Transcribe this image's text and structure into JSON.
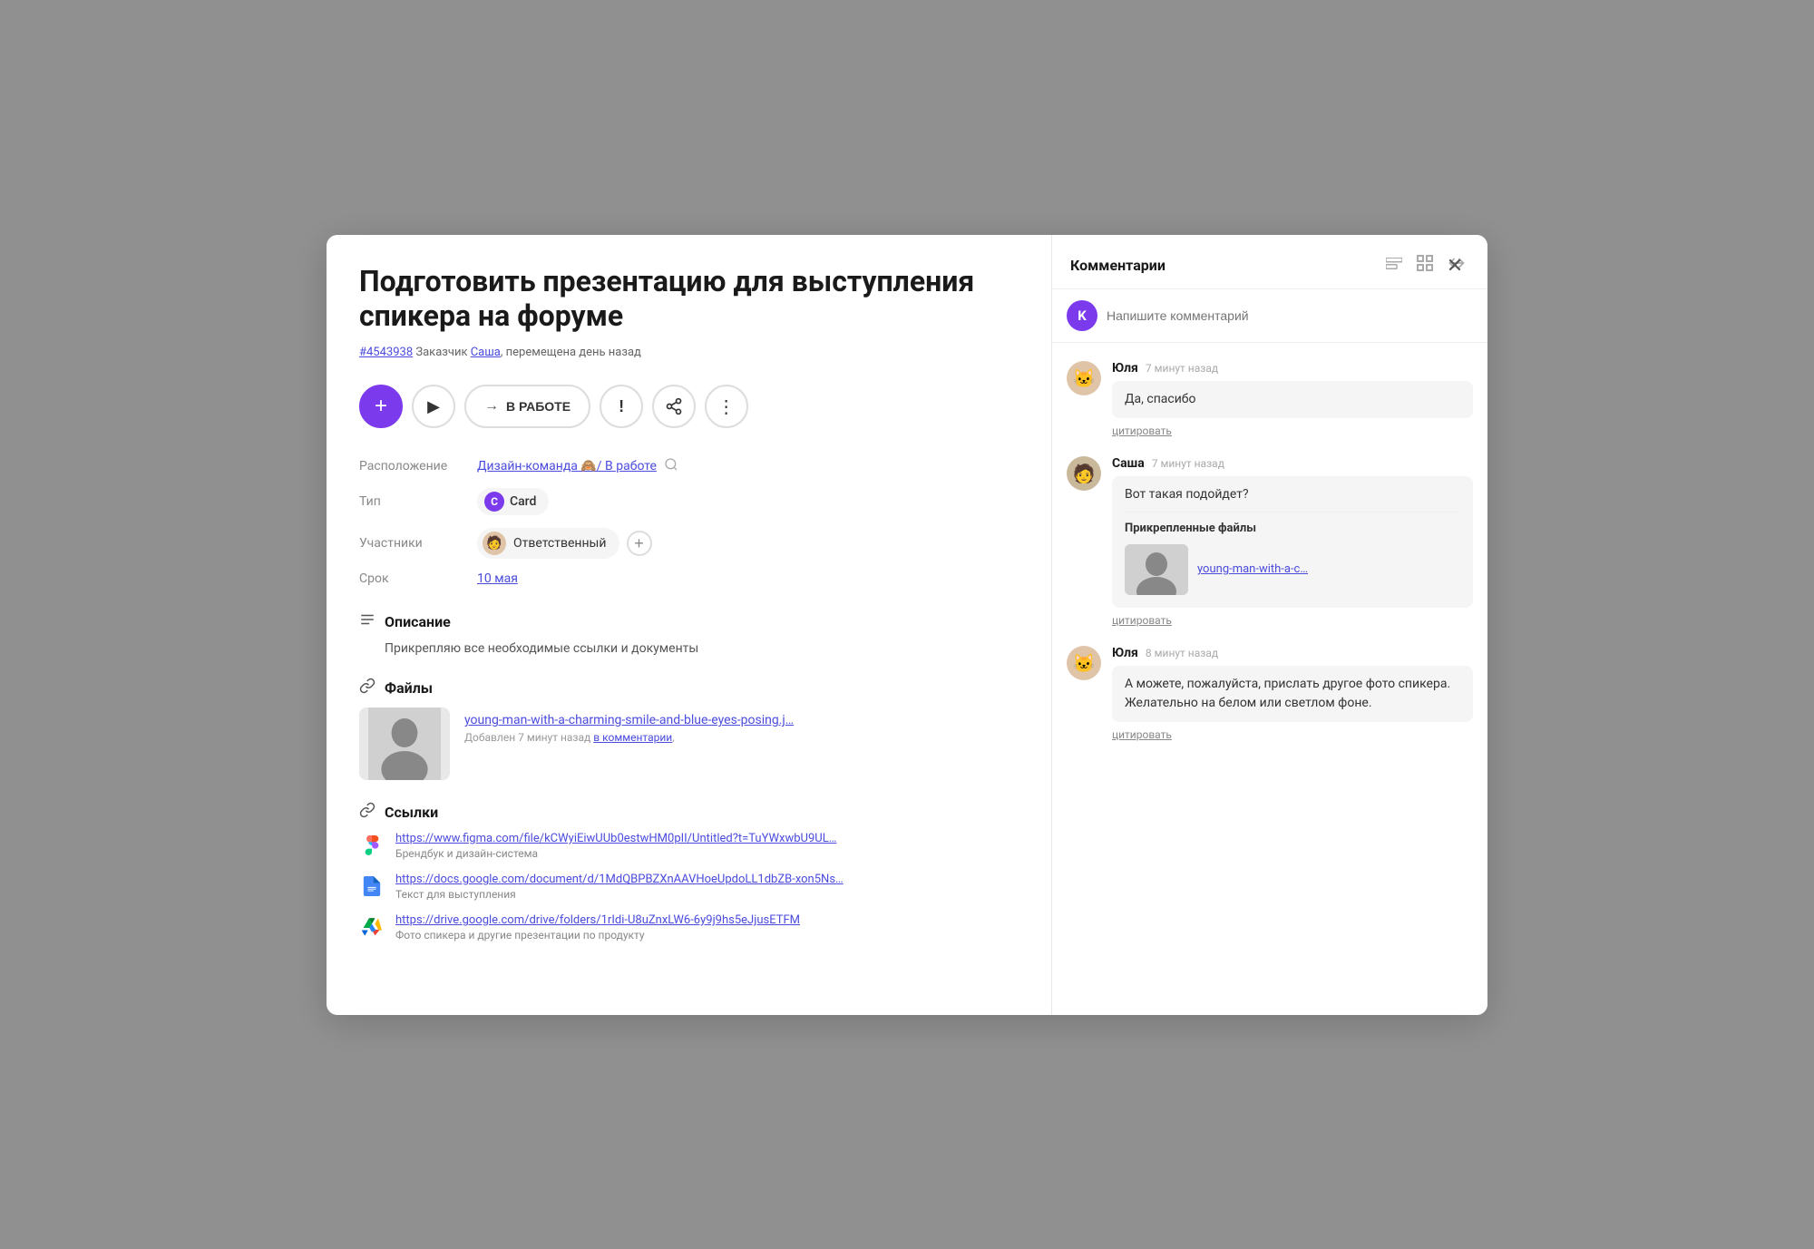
{
  "modal": {
    "close_label": "✕"
  },
  "task": {
    "title": "Подготовить презентацию для выступления спикера на форуме",
    "id": "#4543938",
    "client_label": "Заказчик",
    "client_name": "Саша",
    "moved_label": ", перемещена день назад"
  },
  "actions": {
    "add_label": "+",
    "play_label": "▶",
    "status_arrow": "→",
    "status_label": "В РАБОТЕ",
    "alert_label": "!",
    "share_label": "⋯",
    "more_label": "⋮"
  },
  "fields": {
    "location_label": "Расположение",
    "location_value": "Дизайн-команда 🙈/ В работе",
    "type_label": "Тип",
    "type_icon": "C",
    "type_value": "Card",
    "participants_label": "Участники",
    "participant_name": "Ответственный",
    "deadline_label": "Срок",
    "deadline_value": "10 мая"
  },
  "description": {
    "section_label": "Описание",
    "text": "Прикрепляю все необходимые ссылки и документы"
  },
  "files": {
    "section_label": "Файлы",
    "items": [
      {
        "name": "young-man-with-a-charming-smile-and-blue-eyes-posing.j…",
        "meta": "Добавлен 7 минут назад",
        "in_comments": "в комментарии"
      }
    ]
  },
  "links": {
    "section_label": "Ссылки",
    "items": [
      {
        "icon": "figma",
        "url": "https://www.figma.com/file/kCWyiEiwUUb0estwHM0pII/Untitled?t=TuYWxwbU9UL…",
        "desc": "Брендбук и дизайн-система"
      },
      {
        "icon": "gdocs",
        "url": "https://docs.google.com/document/d/1MdQBPBZXnAAVHoeUpdoLL1dbZB-xon5Ns…",
        "desc": "Текст для выступления"
      },
      {
        "icon": "gdrive",
        "url": "https://drive.google.com/drive/folders/1rIdi-U8uZnxLW6-6y9j9hs5eJjusETFM",
        "desc": "Фото спикера и другие презентации по продукту"
      }
    ]
  },
  "comments": {
    "title": "Комментарии",
    "input_placeholder": "Напишите комментарий",
    "current_user_initial": "K",
    "items": [
      {
        "author": "Юля",
        "time": "7 минут назад",
        "text": "Да, спасибо",
        "quote_label": "цитировать",
        "has_attachment": false,
        "avatar_emoji": "🐱"
      },
      {
        "author": "Саша",
        "time": "7 минут назад",
        "text": "Вот такая подойдет?",
        "quote_label": "цитировать",
        "has_attachment": true,
        "attached_label": "Прикрепленные файлы",
        "attachment_name": "young-man-with-a-c…",
        "avatar_emoji": "🧑"
      },
      {
        "author": "Юля",
        "time": "8 минут назад",
        "text": "А можете, пожалуйста, прислать другое фото спикера. Желательно на белом или светлом фоне.",
        "quote_label": "цитировать",
        "has_attachment": false,
        "avatar_emoji": "🐱"
      }
    ]
  }
}
